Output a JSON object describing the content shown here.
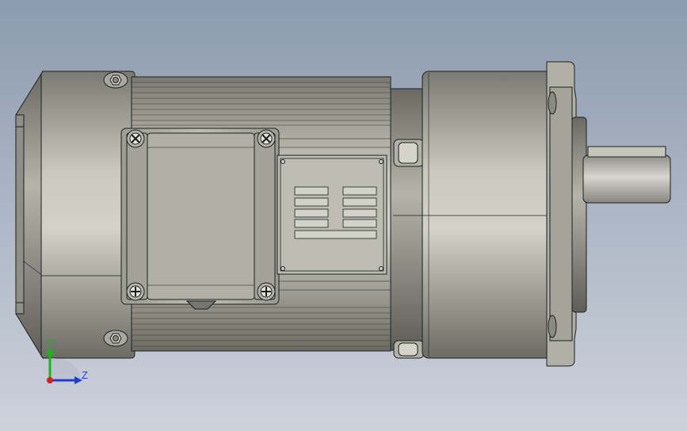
{
  "colors": {
    "background_top": "#8C9BAF",
    "background_bottom": "#CDD2DB",
    "metal_dark": "#6E6E66",
    "metal_mid": "#A4A49A",
    "metal_light": "#CFCFC6",
    "outline": "#1E1E1E",
    "axis_x": "#D81E1E",
    "axis_y": "#19B419",
    "axis_z": "#1E3CD2"
  },
  "triad": {
    "y_label": "Y",
    "z_label": "Z"
  }
}
